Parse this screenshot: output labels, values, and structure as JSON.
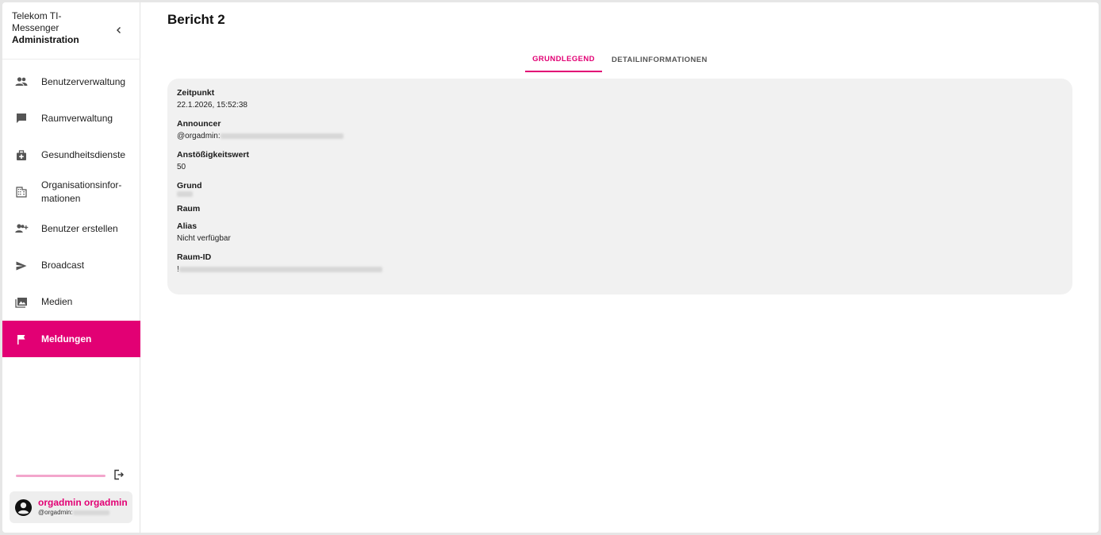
{
  "brand": {
    "line1": "Telekom TI-",
    "line2": "Messenger",
    "line3": "Administration"
  },
  "nav": {
    "items": [
      {
        "label": "Benutzerverwaltung",
        "icon": "users-icon"
      },
      {
        "label": "Raumverwaltung",
        "icon": "chat-icon"
      },
      {
        "label": "Gesundheitsdienste",
        "icon": "medical-bag-icon"
      },
      {
        "label": "Organisationsinfor-\nmationen",
        "icon": "building-icon"
      },
      {
        "label": "Benutzer erstellen",
        "icon": "add-user-icon"
      },
      {
        "label": "Broadcast",
        "icon": "send-icon"
      },
      {
        "label": "Medien",
        "icon": "media-icon"
      },
      {
        "label": "Meldungen",
        "icon": "flag-icon",
        "active": true
      }
    ]
  },
  "user": {
    "name": "orgadmin orgadmin",
    "id_prefix": "@orgadmin:"
  },
  "page": {
    "title": "Bericht 2"
  },
  "tabs": {
    "basic": "GRUNDLEGEND",
    "details": "DETAILINFORMATIONEN"
  },
  "report": {
    "time_label": "Zeitpunkt",
    "time_value": "22.1.2026, 15:52:38",
    "announcer_label": "Announcer",
    "announcer_prefix": "@orgadmin:",
    "score_label": "Anstößigkeitswert",
    "score_value": "50",
    "reason_label": "Grund",
    "room_label": "Raum",
    "alias_label": "Alias",
    "alias_value": "Nicht verfügbar",
    "room_id_label": "Raum-ID",
    "room_id_prefix": "!"
  },
  "colors": {
    "accent": "#e20074",
    "accent_light": "#f3a6cc",
    "card_bg": "#f1f1f1"
  }
}
